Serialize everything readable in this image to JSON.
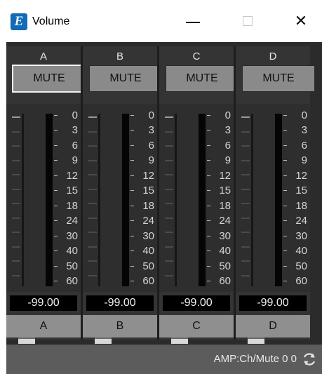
{
  "window": {
    "title": "Volume",
    "app_icon_letter": "E",
    "close_glyph": "✕"
  },
  "channels": [
    {
      "label": "A",
      "mute_label": "MUTE",
      "level": "-99.00",
      "name": "A"
    },
    {
      "label": "B",
      "mute_label": "MUTE",
      "level": "-99.00",
      "name": "B"
    },
    {
      "label": "C",
      "mute_label": "MUTE",
      "level": "-99.00",
      "name": "C"
    },
    {
      "label": "D",
      "mute_label": "MUTE",
      "level": "-99.00",
      "name": "D"
    }
  ],
  "meter_scale": [
    "0",
    "3",
    "6",
    "9",
    "12",
    "15",
    "18",
    "24",
    "30",
    "40",
    "50",
    "60"
  ],
  "fader_level_fraction": 0.0,
  "status": {
    "text": "AMP:Ch/Mute 0 0"
  },
  "icons": {
    "app": "editor-app-icon",
    "refresh": "refresh-icon"
  },
  "colors": {
    "app_icon": "#0f6cbd",
    "panel_bg": "#2b2b2b",
    "button_gray": "#8a8a8a",
    "meter_black": "#050505"
  }
}
